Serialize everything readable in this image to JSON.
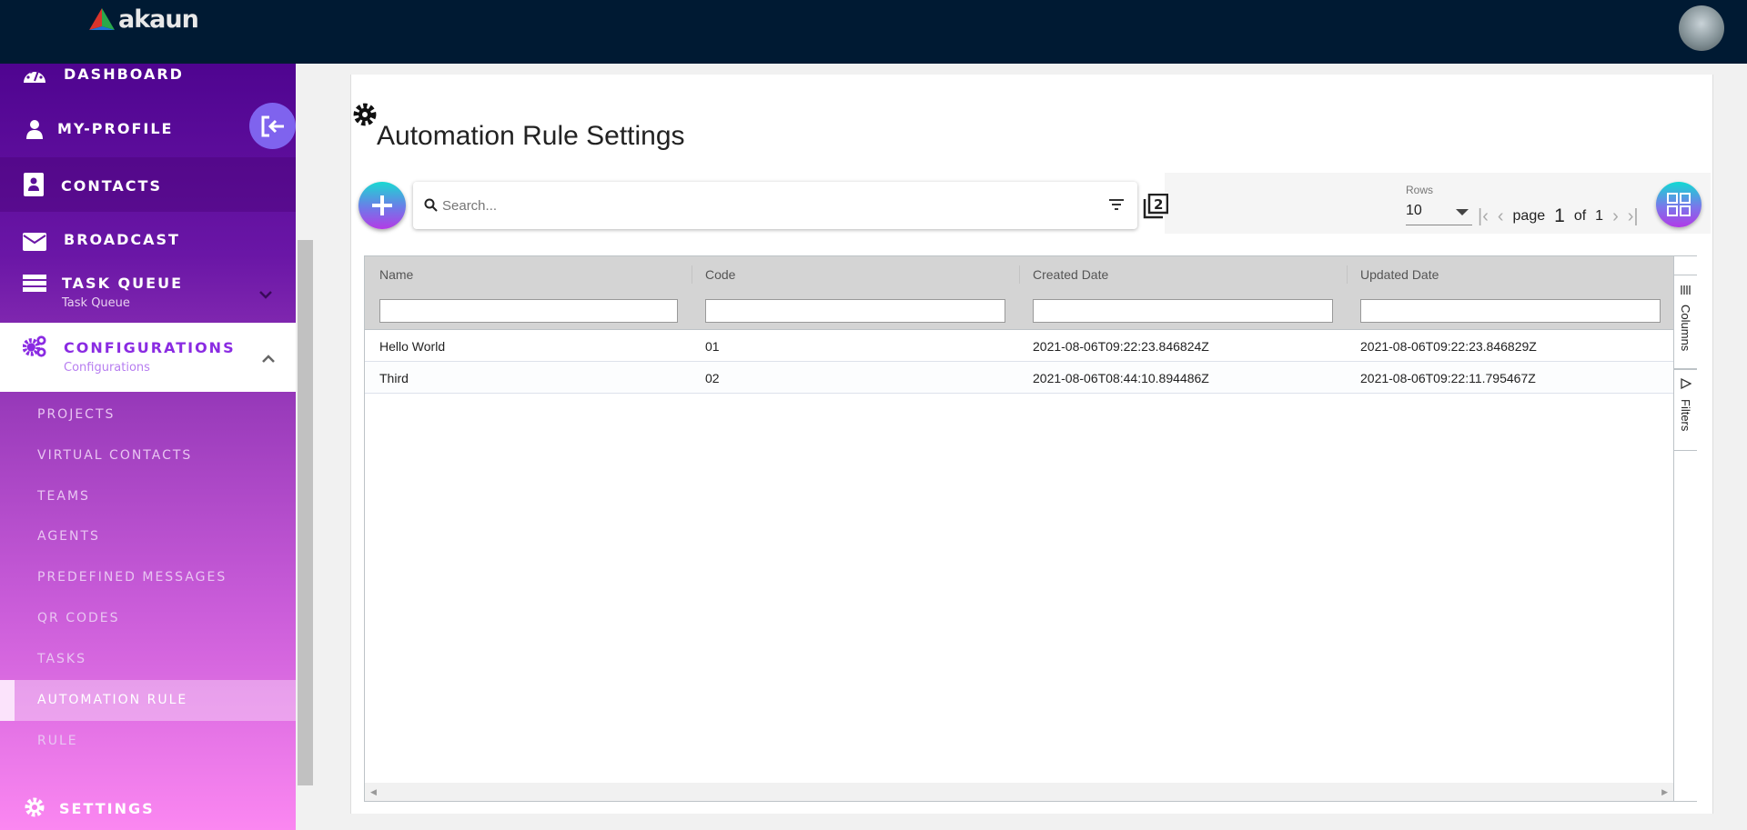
{
  "app": {
    "logo_text": "akaun"
  },
  "sidebar": {
    "items": [
      {
        "label": "DASHBOARD"
      },
      {
        "label": "MY-PROFILE"
      },
      {
        "label": "CONTACTS"
      },
      {
        "label": "BROADCAST"
      },
      {
        "label": "TASK QUEUE",
        "caption": "Task Queue"
      },
      {
        "label": "CONFIGURATIONS",
        "caption": "Configurations"
      },
      {
        "label": "SETTINGS"
      }
    ],
    "subitems": [
      "PROJECTS",
      "VIRTUAL CONTACTS",
      "TEAMS",
      "AGENTS",
      "PREDEFINED MESSAGES",
      "QR CODES",
      "TASKS",
      "AUTOMATION RULE",
      "RULE"
    ]
  },
  "page": {
    "title": "Automation Rule Settings"
  },
  "search": {
    "placeholder": "Search..."
  },
  "pagination": {
    "rows_label": "Rows",
    "rows_value": "10",
    "page_word": "page",
    "page": "1",
    "of_word": "of",
    "total": "1"
  },
  "table": {
    "columns": [
      "Name",
      "Code",
      "Created Date",
      "Updated Date"
    ],
    "rows": [
      [
        "Hello World",
        "01",
        "2021-08-06T09:22:23.846824Z",
        "2021-08-06T09:22:23.846829Z"
      ],
      [
        "Third",
        "02",
        "2021-08-06T08:44:10.894486Z",
        "2021-08-06T09:22:11.795467Z"
      ]
    ],
    "side_tabs": [
      "Columns",
      "Filters"
    ]
  },
  "colors": {
    "topbar": "#001a33",
    "active_config": "#8a2be2",
    "fab_start": "#1ad9d2",
    "fab_end": "#b43be6"
  }
}
